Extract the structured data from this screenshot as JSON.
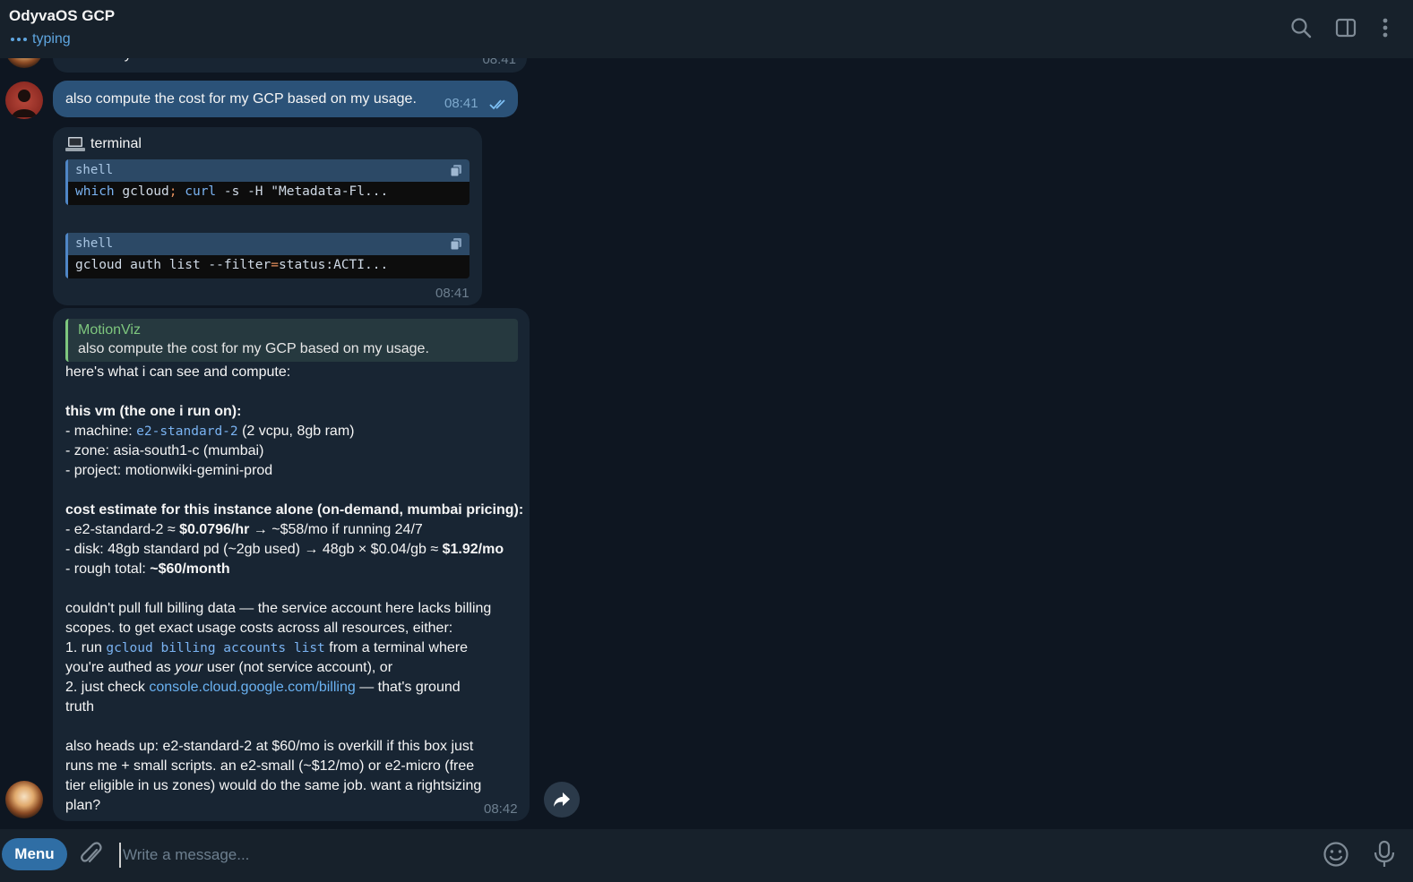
{
  "header": {
    "title": "OdyvaOS GCP",
    "status": "typing",
    "icons": [
      "search-icon",
      "sidebar-toggle-icon",
      "more-vertical-icon"
    ]
  },
  "messages": {
    "partial_prev": {
      "text": "which way?",
      "time": "08:41"
    },
    "user_msg": {
      "text": "also compute the cost for my GCP based on my usage.",
      "time": "08:41"
    },
    "terminal": {
      "title": "terminal",
      "blocks": [
        {
          "lang": "shell",
          "code_parts": [
            {
              "t": "which",
              "k": "kw"
            },
            {
              "t": " gcloud",
              "k": ""
            },
            {
              "t": ";",
              "k": "op"
            },
            {
              "t": " curl",
              "k": "kw"
            },
            {
              "t": " -s -H \"Metadata-Fl...",
              "k": ""
            }
          ]
        },
        {
          "lang": "shell",
          "code_parts": [
            {
              "t": "gcloud auth list --filter",
              "k": ""
            },
            {
              "t": "=",
              "k": "op"
            },
            {
              "t": "status:ACTI...",
              "k": ""
            }
          ]
        }
      ],
      "time": "08:41"
    },
    "reply": {
      "quote_author": "MotionViz",
      "quote_text": "also compute the cost for my GCP based on my usage.",
      "lines": [
        [
          {
            "t": "here's what i can see and compute:"
          }
        ],
        [],
        [
          {
            "t": "this vm (the one i run on):",
            "b": true
          }
        ],
        [
          {
            "t": "- machine: "
          },
          {
            "t": "e2-standard-2",
            "m": true
          },
          {
            "t": " (2 vcpu, 8gb ram)"
          }
        ],
        [
          {
            "t": "- zone: asia-south1-c (mumbai)"
          }
        ],
        [
          {
            "t": "- project: motionwiki-gemini-prod"
          }
        ],
        [],
        [
          {
            "t": "cost estimate for this instance alone (on-demand, mumbai pricing):",
            "b": true
          }
        ],
        [
          {
            "t": "- e2-standard-2 ≈ "
          },
          {
            "t": "$0.0796/hr",
            "b": true
          },
          {
            "t": " → ~$58/mo if running 24/7"
          }
        ],
        [
          {
            "t": "- disk: 48gb standard pd (~2gb used) → 48gb × $0.04/gb ≈ "
          },
          {
            "t": "$1.92/mo",
            "b": true
          }
        ],
        [
          {
            "t": "- rough total: "
          },
          {
            "t": "~$60/month",
            "b": true
          }
        ],
        [],
        [
          {
            "t": "couldn't pull full billing data — the service account here lacks billing"
          }
        ],
        [
          {
            "t": "scopes. to get exact usage costs across all resources, either:"
          }
        ],
        [
          {
            "t": "1. run "
          },
          {
            "t": "gcloud billing accounts list",
            "m": true
          },
          {
            "t": " from a terminal where"
          }
        ],
        [
          {
            "t": "you're authed as "
          },
          {
            "t": "your",
            "i": true
          },
          {
            "t": " user (not service account), or"
          }
        ],
        [
          {
            "t": "2. just check "
          },
          {
            "t": "console.cloud.google.com/billing",
            "l": true
          },
          {
            "t": " — that's ground"
          }
        ],
        [
          {
            "t": "truth"
          }
        ],
        [],
        [
          {
            "t": "also heads up: e2-standard-2 at $60/mo is overkill if this box just"
          }
        ],
        [
          {
            "t": "runs me + small scripts. an e2-small (~$12/mo) or e2-micro (free"
          }
        ],
        [
          {
            "t": "tier eligible in us zones) would do the same job. want a rightsizing"
          }
        ],
        [
          {
            "t": "plan?"
          }
        ]
      ],
      "time": "08:42"
    }
  },
  "composer": {
    "menu_label": "Menu",
    "placeholder": "Write a message..."
  }
}
